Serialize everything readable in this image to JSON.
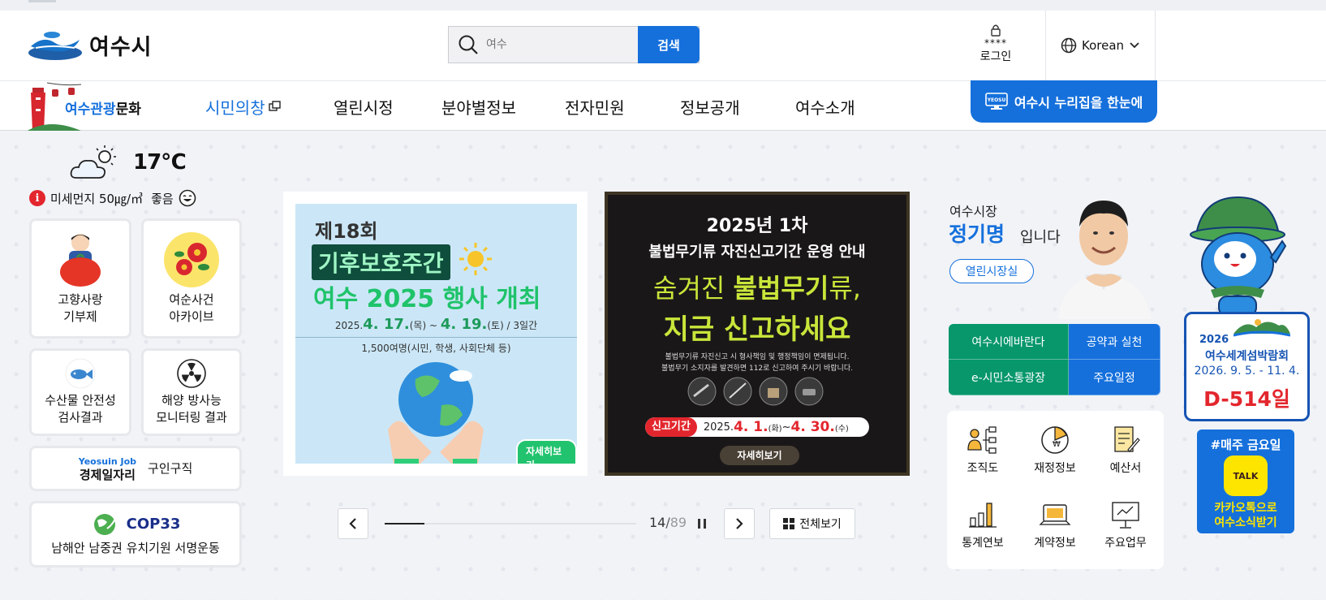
{
  "header": {
    "logo_text": "여수시",
    "search": {
      "placeholder": "여수",
      "button": "검색"
    },
    "login": {
      "stars": "****",
      "label": "로그인"
    },
    "language": "Korean"
  },
  "nav": {
    "tour_prefix": "여수",
    "tour_mid": "관광",
    "tour_suffix": "문화",
    "items": [
      "시민의창",
      "열린시정",
      "분야별정보",
      "전자민원",
      "정보공개",
      "여수소개"
    ],
    "nuri_button": "여수시 누리집을 한눈에",
    "nuri_badge": "YEOSU"
  },
  "weather": {
    "temp": "17℃",
    "dust_label": "미세먼지 50㎍/㎥",
    "dust_status": "좋음",
    "info_glyph": "i"
  },
  "quick": {
    "hometown": [
      "고향사랑",
      "기부제"
    ],
    "yeosun": [
      "여순사건",
      "아카이브"
    ],
    "seafood": [
      "수산물 안전성",
      "검사결과"
    ],
    "radiation": [
      "해양 방사능",
      "모니터링 결과"
    ],
    "job_en": "Yeosuin Job",
    "job_title": "경제일자리",
    "job_label": "구인구직",
    "cop_title": "COP33",
    "cop_label": "남해안 남중권 유치기원 서명운동"
  },
  "slides": {
    "s1": {
      "title1": "제18회",
      "title2": "기후보호주간",
      "title3": "여수 2025 행사 개최",
      "date_a": "2025.",
      "date_b": "4. 17.",
      "date_c": "(목) ~ ",
      "date_d": "4. 19.",
      "date_e": "(토) / 3일간",
      "people": "1,500여명(시민, 학생, 사회단체 등)",
      "more": "자세히보기"
    },
    "s2": {
      "title1": "2025년 1차",
      "title2": "불법무기류 자진신고기간 운영 안내",
      "big1a": "숨겨진 ",
      "big1b": "불법무기",
      "big1c": "류,",
      "big2": "지금 신고하세요",
      "desc1": "불법무기류 자진신고 시 형사책임 및 행정책임이 면제됩니다.",
      "desc2": "불법무기 소지자를 발견하면 112로 신고하여 주시기 바랍니다.",
      "period_label": "신고기간",
      "period_a": "2025.",
      "period_b": "4. 1.",
      "period_c": "(화)",
      "period_d": " ~ ",
      "period_e": "4. 30.",
      "period_f": "(수)",
      "more": "자세히보기"
    },
    "counter_current": "14",
    "counter_total": "89",
    "progress": 0.157,
    "view_all": "전체보기"
  },
  "mayor": {
    "line1": "여수시장",
    "name": "정기명",
    "suffix": "입니다",
    "button": "열린시장실"
  },
  "links": {
    "l1": "여수시에바란다",
    "l2": "공약과 실천",
    "l3": "e-시민소통광장",
    "l4": "주요일정",
    "colors": {
      "green": "#07976b",
      "blue": "#1570dc"
    }
  },
  "info": [
    "조직도",
    "재정정보",
    "예산서",
    "통계연보",
    "계약정보",
    "주요업무"
  ],
  "expo": {
    "year": "2026",
    "name": "여수세계섬박람회",
    "dates": "2026. 9. 5. - 11. 4.",
    "dday": "D-514일"
  },
  "kakao": {
    "week": "#매주 금요일",
    "talk": "TALK",
    "line1": "카카오톡으로",
    "line2": "여수소식받기"
  },
  "colors": {
    "primary": "#1570dc",
    "red": "#e3262d",
    "dark_green": "#0f4d3c",
    "yellow_green": "#c8e63a"
  }
}
